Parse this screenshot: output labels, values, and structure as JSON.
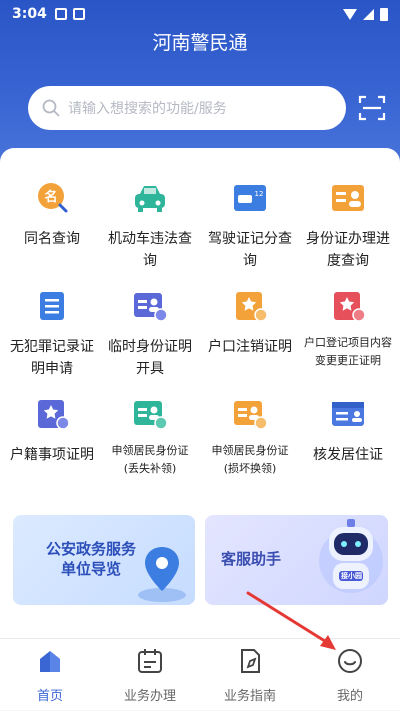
{
  "status_bar": {
    "time": "3:04"
  },
  "header": {
    "title": "河南警民通"
  },
  "search": {
    "placeholder": "请输入想搜索的功能/服务"
  },
  "services": [
    {
      "label": "同名查询",
      "icon": "name-search-icon"
    },
    {
      "label": "机动车违法查询",
      "icon": "car-icon"
    },
    {
      "label": "驾驶证记分查询",
      "icon": "license-card-icon"
    },
    {
      "label": "身份证办理进度查询",
      "icon": "id-card-icon"
    },
    {
      "label": "无犯罪记录证明申请",
      "icon": "document-icon"
    },
    {
      "label": "临时身份证明开具",
      "icon": "temp-id-icon"
    },
    {
      "label": "户口注销证明",
      "icon": "household-cancel-icon"
    },
    {
      "label": "户口登记项目内容变更更正证明",
      "icon": "household-change-icon"
    },
    {
      "label": "户籍事项证明",
      "icon": "household-register-icon"
    },
    {
      "label": "申领居民身份证(丢失补领)",
      "icon": "id-reissue-icon"
    },
    {
      "label": "申领居民身份证(损坏换领)",
      "icon": "id-replace-icon"
    },
    {
      "label": "核发居住证",
      "icon": "residence-permit-icon"
    }
  ],
  "banners": {
    "left": {
      "text": "公安政务服务单位导览",
      "line1": "公安政务服务",
      "line2": "单位导览"
    },
    "right": {
      "text": "客服助手",
      "robot_badge": "接小园"
    }
  },
  "tabs": [
    {
      "label": "首页",
      "icon": "home-icon",
      "active": true
    },
    {
      "label": "业务办理",
      "icon": "calendar-icon",
      "active": false
    },
    {
      "label": "业务指南",
      "icon": "guide-icon",
      "active": false
    },
    {
      "label": "我的",
      "icon": "profile-icon",
      "active": false
    }
  ],
  "colors": {
    "primary": "#3a66d4",
    "orange": "#f3a23a",
    "teal": "#2fb59a",
    "indigo": "#5a68d8",
    "red": "#e5505a",
    "annotation": "#e53935"
  }
}
